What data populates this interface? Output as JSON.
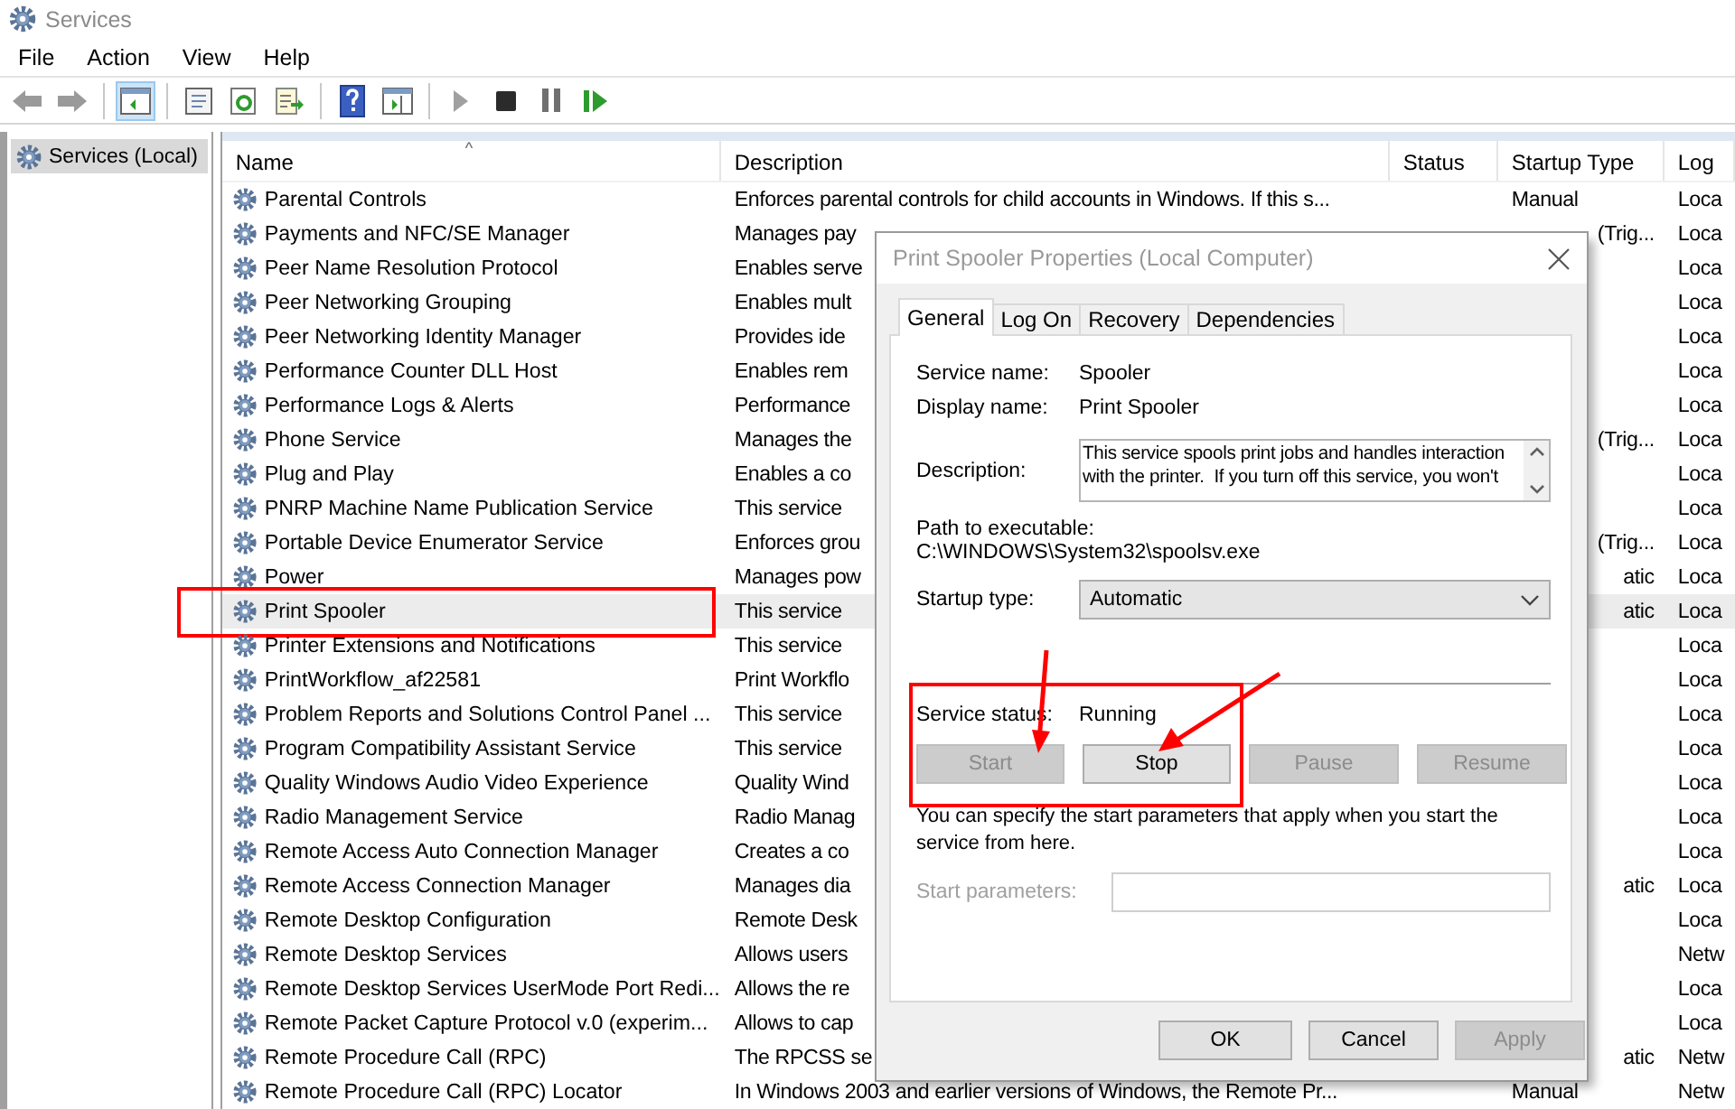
{
  "window": {
    "title": "Services"
  },
  "menu": [
    "File",
    "Action",
    "View",
    "Help"
  ],
  "toolbar": [
    {
      "selected": false
    },
    {
      "selected": false
    },
    {
      "selected": true
    },
    {
      "selected": false
    },
    {
      "selected": false
    },
    {
      "selected": false
    },
    {
      "selected": false
    },
    {
      "selected": false
    },
    {
      "selected": false
    },
    {
      "selected": false
    },
    {
      "selected": false
    },
    {
      "selected": false
    }
  ],
  "tree": [
    {
      "label": "Services (Local)",
      "selected": true
    }
  ],
  "table": {
    "columns": [
      {
        "label": "Name",
        "sort_mark": "^"
      },
      {
        "label": "Description"
      },
      {
        "label": "Status"
      },
      {
        "label": "Startup Type"
      },
      {
        "label": "Log"
      }
    ],
    "rows": [
      {
        "name": "Parental Controls",
        "description": "Enforces parental controls for child accounts in Windows. If this s...",
        "startup_type": "Manual",
        "startup_clipped": false,
        "log_on": "Loca",
        "selected": false,
        "highlighted": false
      },
      {
        "name": "Payments and NFC/SE Manager",
        "description": "Manages pay",
        "startup_type": "(Trig...",
        "startup_clipped": true,
        "log_on": "Loca",
        "selected": false,
        "highlighted": false
      },
      {
        "name": "Peer Name Resolution Protocol",
        "description": "Enables serve",
        "log_on": "Loca",
        "selected": false,
        "highlighted": false
      },
      {
        "name": "Peer Networking Grouping",
        "description": "Enables mult",
        "log_on": "Loca",
        "selected": false,
        "highlighted": false
      },
      {
        "name": "Peer Networking Identity Manager",
        "description": "Provides ide",
        "log_on": "Loca",
        "selected": false,
        "highlighted": false
      },
      {
        "name": "Performance Counter DLL Host",
        "description": "Enables rem",
        "log_on": "Loca",
        "selected": false,
        "highlighted": false
      },
      {
        "name": "Performance Logs & Alerts",
        "description": "Performance",
        "log_on": "Loca",
        "selected": false,
        "highlighted": false
      },
      {
        "name": "Phone Service",
        "description": "Manages the",
        "startup_type": "(Trig...",
        "startup_clipped": true,
        "log_on": "Loca",
        "selected": false,
        "highlighted": false
      },
      {
        "name": "Plug and Play",
        "description": "Enables a co",
        "log_on": "Loca",
        "selected": false,
        "highlighted": false
      },
      {
        "name": "PNRP Machine Name Publication Service",
        "description": "This service",
        "log_on": "Loca",
        "selected": false,
        "highlighted": false
      },
      {
        "name": "Portable Device Enumerator Service",
        "description": "Enforces grou",
        "startup_type": "(Trig...",
        "startup_clipped": true,
        "log_on": "Loca",
        "selected": false,
        "highlighted": false
      },
      {
        "name": "Power",
        "description": "Manages pow",
        "startup_type": "atic",
        "startup_clipped": true,
        "log_on": "Loca",
        "selected": false,
        "highlighted": false
      },
      {
        "name": "Print Spooler",
        "description": "This service",
        "startup_type": "atic",
        "startup_clipped": true,
        "log_on": "Loca",
        "selected": true,
        "highlighted": true
      },
      {
        "name": "Printer Extensions and Notifications",
        "description": "This service",
        "log_on": "Loca",
        "selected": false,
        "highlighted": false
      },
      {
        "name": "PrintWorkflow_af22581",
        "description": "Print Workflo",
        "log_on": "Loca",
        "selected": false,
        "highlighted": false
      },
      {
        "name": "Problem Reports and Solutions Control Panel ...",
        "description": "This service",
        "log_on": "Loca",
        "selected": false,
        "highlighted": false
      },
      {
        "name": "Program Compatibility Assistant Service",
        "description": "This service",
        "log_on": "Loca",
        "selected": false,
        "highlighted": false
      },
      {
        "name": "Quality Windows Audio Video Experience",
        "description": "Quality Wind",
        "log_on": "Loca",
        "selected": false,
        "highlighted": false
      },
      {
        "name": "Radio Management Service",
        "description": "Radio Manag",
        "log_on": "Loca",
        "selected": false,
        "highlighted": false
      },
      {
        "name": "Remote Access Auto Connection Manager",
        "description": "Creates a co",
        "log_on": "Loca",
        "selected": false,
        "highlighted": false
      },
      {
        "name": "Remote Access Connection Manager",
        "description": "Manages dia",
        "startup_type": "atic",
        "startup_clipped": true,
        "log_on": "Loca",
        "selected": false,
        "highlighted": false
      },
      {
        "name": "Remote Desktop Configuration",
        "description": "Remote Desk",
        "log_on": "Loca",
        "selected": false,
        "highlighted": false
      },
      {
        "name": "Remote Desktop Services",
        "description": "Allows users",
        "log_on": "Netw",
        "selected": false,
        "highlighted": false
      },
      {
        "name": "Remote Desktop Services UserMode Port Redi...",
        "description": "Allows the re",
        "log_on": "Loca",
        "selected": false,
        "highlighted": false
      },
      {
        "name": "Remote Packet Capture Protocol v.0 (experim...",
        "description": "Allows to cap",
        "log_on": "Loca",
        "selected": false,
        "highlighted": false
      },
      {
        "name": "Remote Procedure Call (RPC)",
        "description": "The RPCSS se",
        "startup_type": "atic",
        "startup_clipped": true,
        "log_on": "Netw",
        "selected": false,
        "highlighted": false
      },
      {
        "name": "Remote Procedure Call (RPC) Locator",
        "description": "In Windows 2003 and earlier versions of Windows, the Remote Pr...",
        "startup_type": "Manual",
        "startup_clipped": false,
        "log_on": "Netw",
        "selected": false,
        "highlighted": false
      }
    ]
  },
  "dialog": {
    "title": "Print Spooler Properties (Local Computer)",
    "tabs": [
      {
        "label": "General",
        "selected": true
      },
      {
        "label": "Log On",
        "selected": false
      },
      {
        "label": "Recovery",
        "selected": false
      },
      {
        "label": "Dependencies",
        "selected": false
      }
    ],
    "service_name": {
      "label": "Service name:",
      "value": "Spooler"
    },
    "display_name": {
      "label": "Display name:",
      "value": "Print Spooler"
    },
    "description": {
      "label": "Description:",
      "value": "This service spools print jobs and handles interaction\nwith the printer.  If you turn off this service, you won't"
    },
    "path": {
      "label": "Path to executable:",
      "value": "C:\\WINDOWS\\System32\\spoolsv.exe"
    },
    "startup_type": {
      "label": "Startup type:",
      "value": "Automatic"
    },
    "service_status": {
      "label": "Service status:",
      "value": "Running",
      "highlighted": true
    },
    "control_buttons": [
      {
        "label": "Start",
        "disabled": true,
        "arrow": true
      },
      {
        "label": "Stop",
        "disabled": false,
        "arrow": true
      },
      {
        "label": "Pause",
        "disabled": true,
        "arrow": false
      },
      {
        "label": "Resume",
        "disabled": true,
        "arrow": false
      }
    ],
    "note": "You can specify the start parameters that apply when you start the service from here.",
    "start_parameters": {
      "label": "Start parameters:",
      "disabled": true
    },
    "buttons": [
      {
        "label": "OK",
        "disabled": false
      },
      {
        "label": "Cancel",
        "disabled": false
      },
      {
        "label": "Apply",
        "disabled": true
      }
    ]
  }
}
